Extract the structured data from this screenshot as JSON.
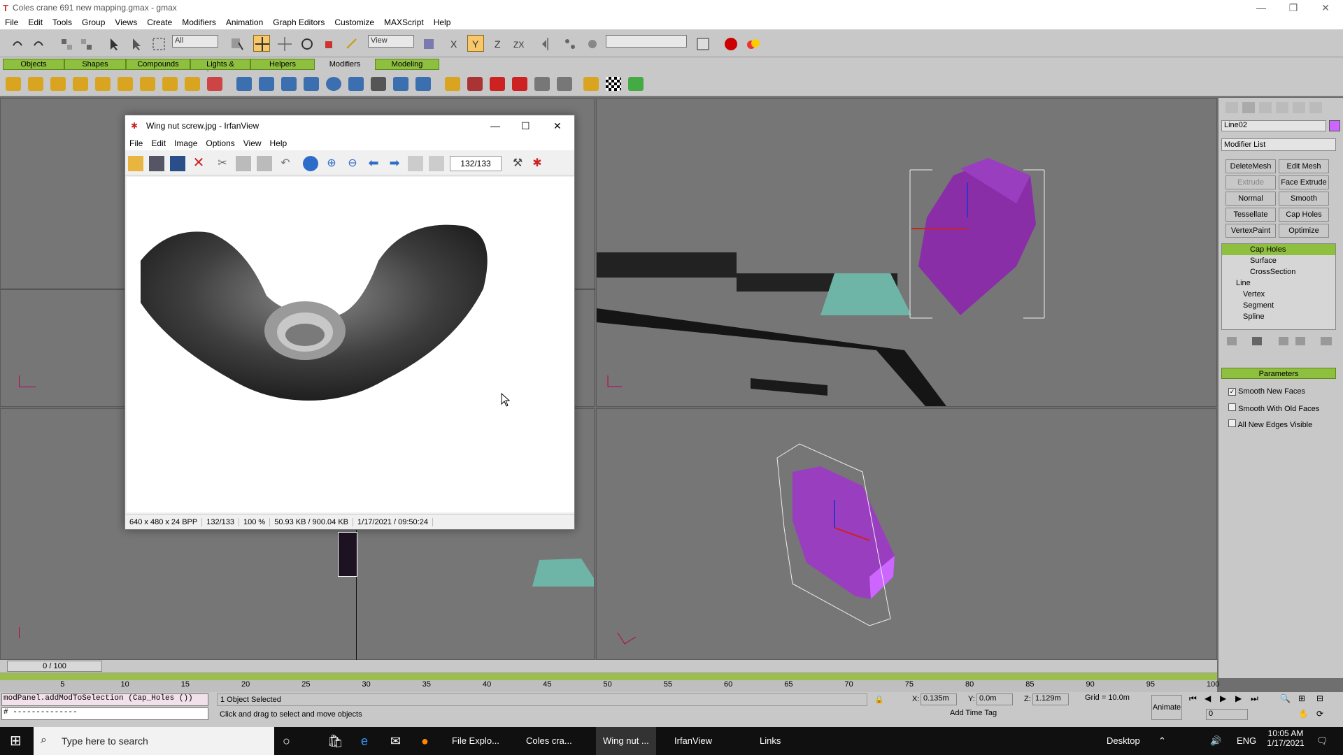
{
  "window": {
    "title": "Coles crane 691 new mapping.gmax - gmax",
    "minimize": "—",
    "restore": "❐",
    "close": "✕"
  },
  "menu": [
    "File",
    "Edit",
    "Tools",
    "Group",
    "Views",
    "Create",
    "Modifiers",
    "Animation",
    "Graph Editors",
    "Customize",
    "MAXScript",
    "Help"
  ],
  "toolbar": {
    "selection_filter": "All",
    "ref_coord": "View"
  },
  "tabs": [
    "Objects",
    "Shapes",
    "Compounds",
    "Lights & Cameras",
    "Helpers",
    "Modifiers",
    "Modeling"
  ],
  "irfan": {
    "title": "Wing nut screw.jpg - IrfanView",
    "menu": [
      "File",
      "Edit",
      "Image",
      "Options",
      "View",
      "Help"
    ],
    "counter": "132/133",
    "status": [
      "640 x 480 x 24 BPP",
      "132/133",
      "100 %",
      "50.93 KB / 900.04 KB",
      "1/17/2021 / 09:50:24"
    ]
  },
  "panel": {
    "object_name": "Line02",
    "modifier_list": "Modifier List",
    "buttons": [
      "DeleteMesh",
      "Edit Mesh",
      "Extrude",
      "Face Extrude",
      "Normal",
      "Smooth",
      "Tessellate",
      "Cap Holes",
      "VertexPaint",
      "Optimize"
    ],
    "stack": [
      "Cap Holes",
      "Surface",
      "CrossSection",
      "Line",
      "Vertex",
      "Segment",
      "Spline"
    ],
    "rollout": "Parameters",
    "options": [
      {
        "label": "Smooth New Faces",
        "checked": true
      },
      {
        "label": "Smooth With Old Faces",
        "checked": false
      },
      {
        "label": "All New Edges Visible",
        "checked": false
      }
    ],
    "accent": "#cc66ff"
  },
  "timeline": {
    "frame": "0 / 100",
    "ticks": [
      "5",
      "10",
      "15",
      "20",
      "25",
      "30",
      "35",
      "40",
      "45",
      "50",
      "55",
      "60",
      "65",
      "70",
      "75",
      "80",
      "85",
      "90",
      "95",
      "100"
    ]
  },
  "bottom": {
    "maxscript": "modPanel.addModToSelection (Cap_Holes ())",
    "maxscript2": "# --------------",
    "status": "1 Object Selected",
    "prompt": "Click and drag to select and move objects",
    "x": "0.135m",
    "y": "0.0m",
    "z": "1.129m",
    "grid": "Grid = 10.0m",
    "addtime": "Add Time Tag",
    "animate": "Animate",
    "frame": "0"
  },
  "taskbar": {
    "search": "Type here to search",
    "apps": [
      "File Explo...",
      "Coles cra...",
      "Wing nut ...",
      "IrfanView"
    ],
    "links": "Links",
    "desktop": "Desktop",
    "lang": "ENG",
    "time": "10:05 AM",
    "date": "1/17/2021"
  }
}
